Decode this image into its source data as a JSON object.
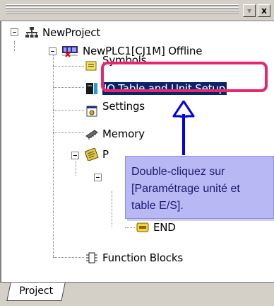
{
  "window": {
    "minimize_glyph": "▾",
    "close_glyph": "x"
  },
  "tree": {
    "project": {
      "label": "NewProject",
      "icon": "network-icon"
    },
    "plc": {
      "label": "NewPLC1[CJ1M] Offline",
      "icon": "plc-offline-icon"
    },
    "symbols": {
      "label": "Symbols",
      "icon": "symbols-icon"
    },
    "io_table": {
      "label": "IO Table and Unit Setup",
      "icon": "io-table-icon",
      "selected": true
    },
    "settings": {
      "label": "Settings",
      "icon": "settings-icon"
    },
    "memory": {
      "label": "Memory",
      "icon": "memory-icon"
    },
    "programs": {
      "label": "P",
      "icon": "programs-icon"
    },
    "end": {
      "label": "END",
      "icon": "section-icon"
    },
    "function_blocks": {
      "label": "Function Blocks",
      "icon": "function-block-icon"
    }
  },
  "callout": {
    "text": "Double-cliquez sur\n[Paramétrage unité et\ntable E/S].",
    "background": "#b8b9f4",
    "border_color": "#e8266f",
    "arrow_color": "#0000ee"
  },
  "tabs": [
    {
      "label": "Project",
      "active": true
    }
  ]
}
